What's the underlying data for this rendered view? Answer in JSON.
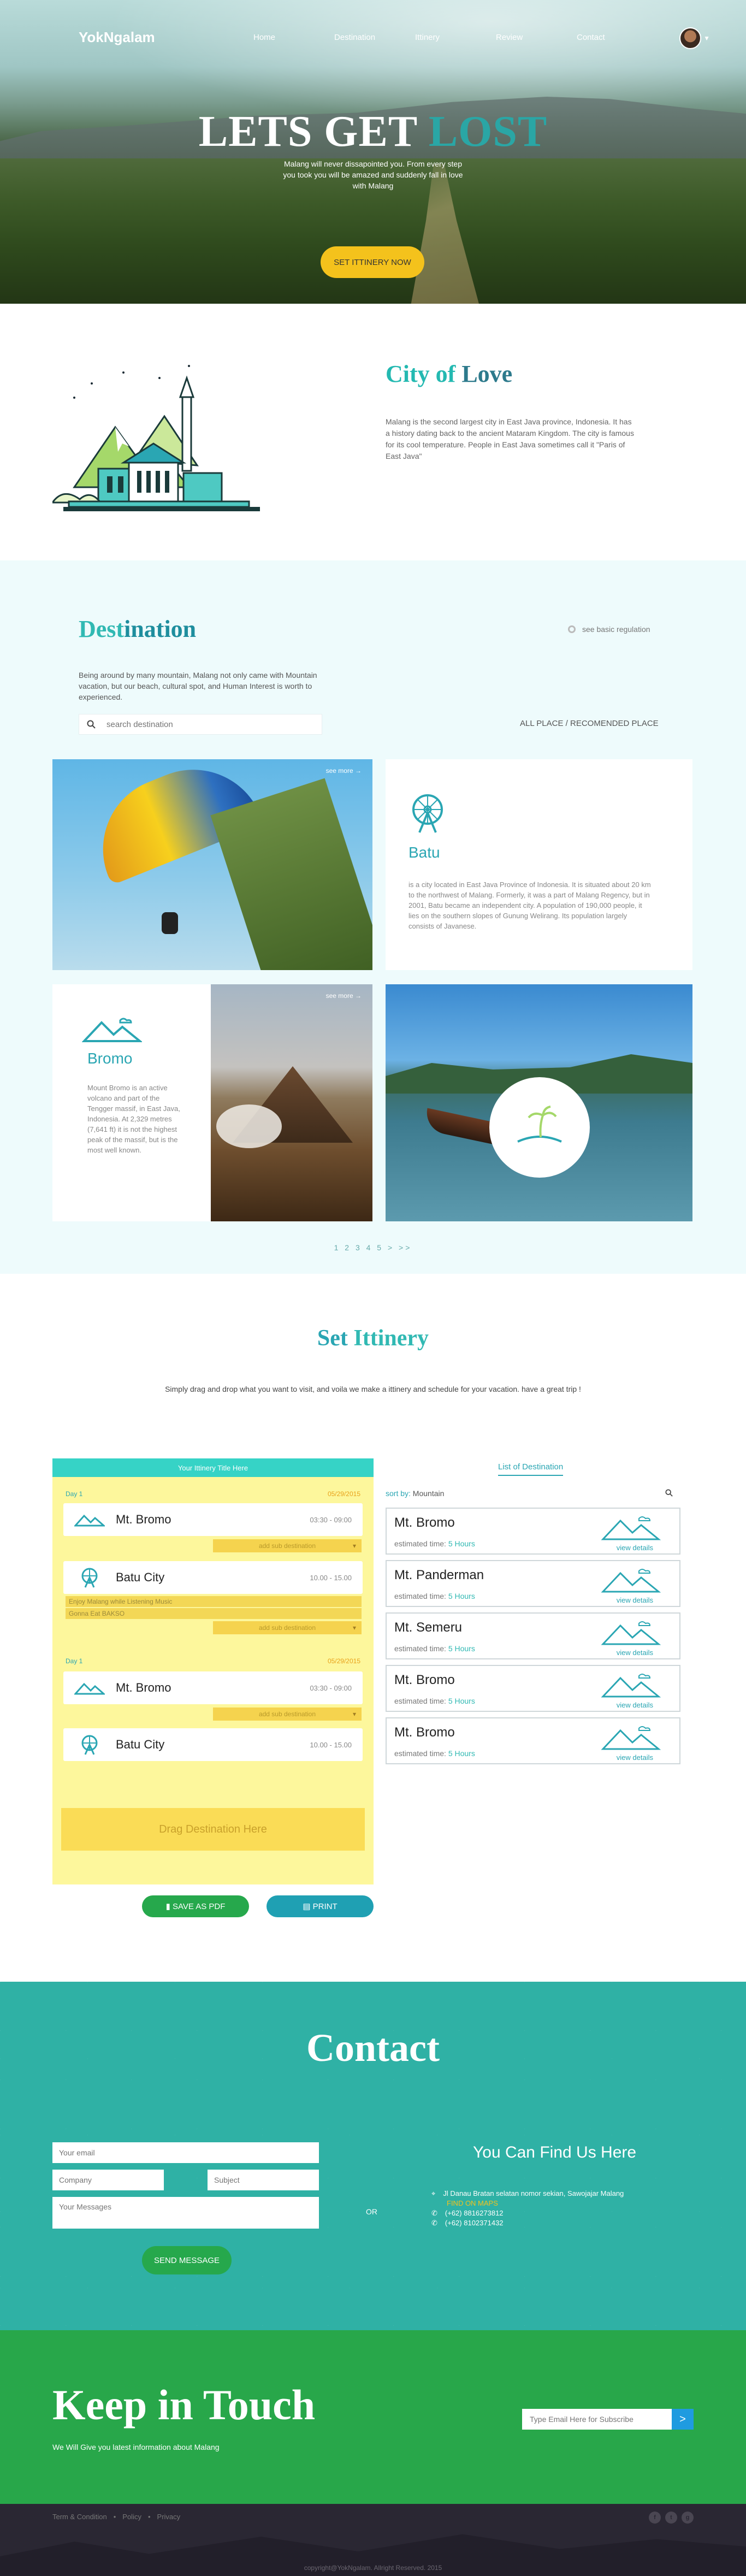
{
  "nav": {
    "logo": "YokNgalam",
    "links": [
      "Home",
      "Destination",
      "Ittinery",
      "Review",
      "Contact"
    ]
  },
  "hero": {
    "title_a": "LETS GET ",
    "title_b": "LOST",
    "subtitle": "Malang will never dissapointed you. From every step you took you will be amazed and suddenly fall in love with Malang",
    "cta": "SET ITTINERY NOW"
  },
  "city": {
    "title_a": "City of ",
    "title_b": "Love",
    "text": "Malang is the second largest city in East Java province, Indonesia. It has a history dating back to the ancient Mataram Kingdom. The city is famous for its cool temperature. People in East Java sometimes call it \"Paris of East Java\""
  },
  "destination": {
    "title_a": "Dest",
    "title_b": "ination",
    "regulation": "see basic regulation",
    "desc": "Being around by many mountain, Malang not only came with Mountain vacation, but our beach, cultural spot, and Human Interest is worth to experienced.",
    "search_placeholder": "search destination",
    "filter": "ALL PLACE / RECOMENDED PLACE",
    "see_more": "see more",
    "batu": {
      "name": "Batu",
      "text": "is a city located in East Java Province of Indonesia. It is situated about 20 km to the northwest of Malang. Formerly, it was a part of Malang Regency, but in 2001, Batu became an independent city. A population of 190,000 people, it lies on the southern slopes of Gunung Welirang. Its population largely consists of Javanese."
    },
    "bromo": {
      "name": "Bromo",
      "text": "Mount Bromo is an active volcano and part of the Tengger massif, in East Java, Indonesia. At 2,329 metres (7,641 ft) it is not the highest peak of the massif, but is the most well known."
    },
    "pager": "1 2 3 4 5 > >>"
  },
  "itinerary": {
    "title_a": "Set ",
    "title_b": "Ittinery",
    "subtitle": "Simply drag and drop what you want to visit, and voila we make a ittinery and schedule for your vacation. have a great trip !",
    "board_title": "Your Ittinery Title Here",
    "days": [
      {
        "label": "Day 1",
        "date": "05/29/2015"
      },
      {
        "label": "Day 1",
        "date": "05/29/2015"
      }
    ],
    "stops": [
      {
        "name": "Mt. Bromo",
        "time": "03:30 - 09:00"
      },
      {
        "name": "Batu City",
        "time": "10.00 - 15.00"
      },
      {
        "name": "Mt. Bromo",
        "time": "03:30 - 09:00"
      },
      {
        "name": "Batu City",
        "time": "10.00 - 15.00"
      }
    ],
    "add_sub": "add sub destination",
    "memo_1": "Enjoy Malang while Listening Music",
    "memo_2": "Gonna Eat BAKSO",
    "drag": "Drag Destination Here",
    "save_pdf": "SAVE AS PDF",
    "print": "PRINT",
    "list_tab": "List of Destination",
    "sort_label": "sort by:",
    "sort_value": "Mountain",
    "est_label": "estimated time:",
    "view_details": "view details",
    "list": [
      {
        "name": "Mt. Bromo",
        "hours": "5 Hours"
      },
      {
        "name": "Mt. Panderman",
        "hours": "5 Hours"
      },
      {
        "name": "Mt. Semeru",
        "hours": "5 Hours"
      },
      {
        "name": "Mt. Bromo",
        "hours": "5 Hours"
      },
      {
        "name": "Mt. Bromo",
        "hours": "5 Hours"
      }
    ]
  },
  "contact": {
    "title": "Contact",
    "email": "Your email",
    "company": "Company",
    "subject": "Subject",
    "messages": "Your Messages",
    "or": "OR",
    "send": "SEND MESSAGE",
    "find_title": "You Can Find Us Here",
    "address": "Jl Danau Bratan selatan nomor sekian, Sawojajar Malang",
    "maps": "FIND ON MAPS",
    "phone_1": "(+62) 8816273812",
    "phone_2": "(+62) 8102371432"
  },
  "touch": {
    "title": "Keep in Touch",
    "subtitle": "We Will Give you latest information about Malang",
    "placeholder": "Type Email Here for Subscribe",
    "button": ">"
  },
  "footer": {
    "links": [
      "Term & Condition",
      "Policy",
      "Privacy"
    ],
    "sep": "•",
    "copyright": "copyright@YokNgalam. Allright Reserved. 2015"
  },
  "colors": {
    "teal": "#2aa6b3",
    "gold": "#f4c21c",
    "green": "#28a74a"
  }
}
